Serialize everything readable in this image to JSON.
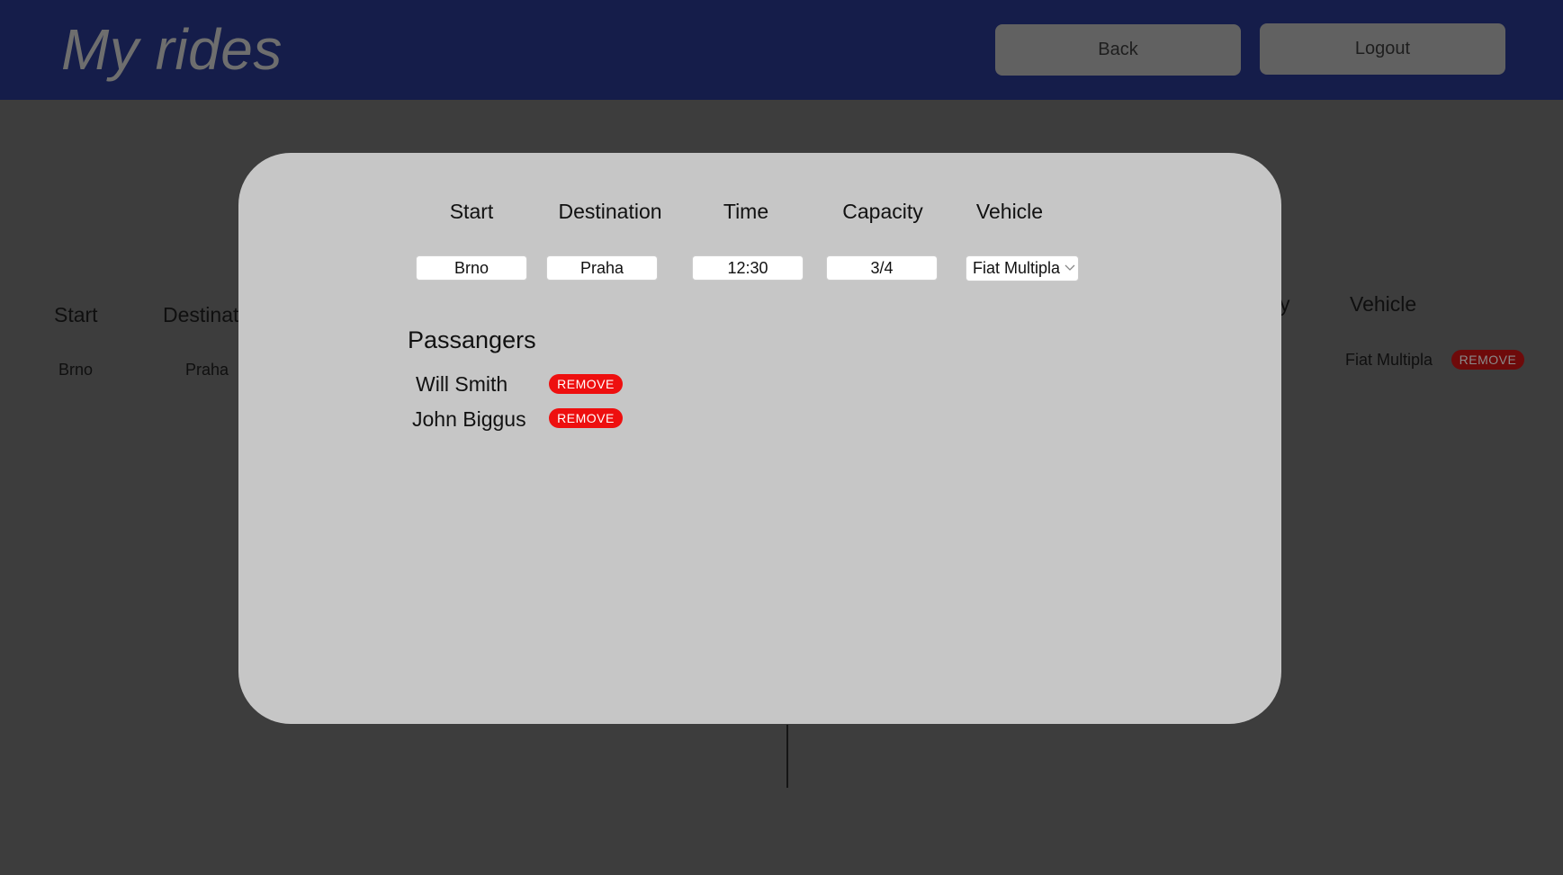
{
  "header": {
    "title": "My rides",
    "back_label": "Back",
    "logout_label": "Logout"
  },
  "background_table": {
    "headers": {
      "start": "Start",
      "destination_partial": "Destinat",
      "capacity_partial": "y",
      "vehicle": "Vehicle"
    },
    "row": {
      "start": "Brno",
      "destination": "Praha",
      "vehicle": "Fiat Multipla",
      "remove_label": "REMOVE"
    }
  },
  "modal": {
    "columns": [
      "Start",
      "Destination",
      "Time",
      "Capacity",
      "Vehicle"
    ],
    "fields": {
      "start": "Brno",
      "destination": "Praha",
      "time": "12:30",
      "capacity": "3/4",
      "vehicle": "Fiat Multipla"
    },
    "passengers_title": "Passangers",
    "passengers": [
      {
        "name": "Will Smith",
        "remove_label": "REMOVE"
      },
      {
        "name": "John Biggus",
        "remove_label": "REMOVE"
      }
    ]
  },
  "colors": {
    "header_bg": "#151d4a",
    "page_bg": "#3d3d3d",
    "modal_bg": "#c6c6c6",
    "remove_red": "#ee0f0f"
  }
}
